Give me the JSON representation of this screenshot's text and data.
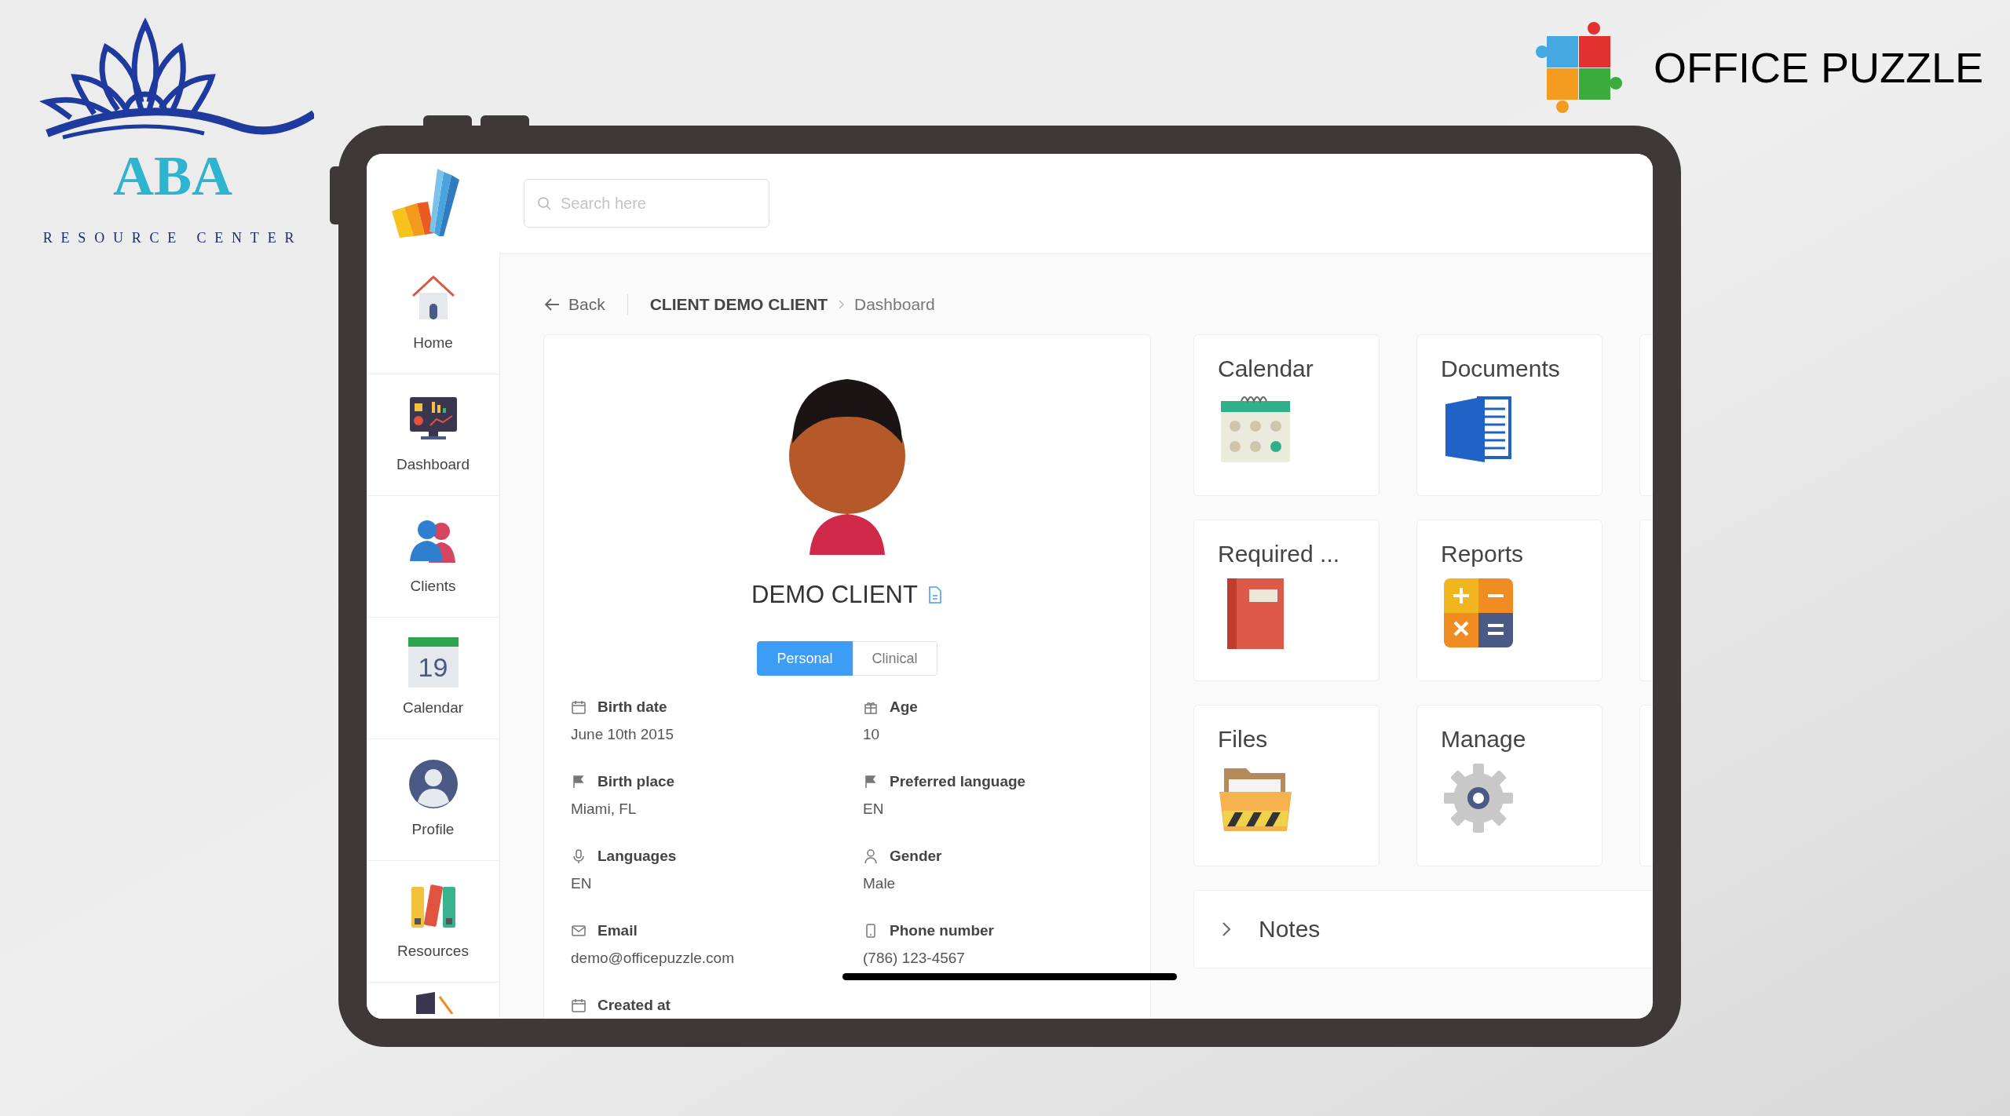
{
  "brand_left": {
    "title": "ABA",
    "subtitle": "RESOURCE CENTER"
  },
  "brand_right": {
    "title": "OFFICE PUZZLE"
  },
  "app": {
    "search": {
      "placeholder": "Search here"
    },
    "sidebar": {
      "items": [
        {
          "label": "Home",
          "kind": "home"
        },
        {
          "label": "Dashboard",
          "kind": "dashboard"
        },
        {
          "label": "Clients",
          "kind": "clients"
        },
        {
          "label": "Calendar",
          "kind": "calendar",
          "icon_text": "19"
        },
        {
          "label": "Profile",
          "kind": "profile"
        },
        {
          "label": "Resources",
          "kind": "resources"
        }
      ]
    },
    "breadcrumb": {
      "back": "Back",
      "items": [
        "CLIENT DEMO CLIENT",
        "Dashboard"
      ]
    },
    "client": {
      "name": "DEMO CLIENT",
      "tabs": [
        {
          "label": "Personal",
          "selected": true
        },
        {
          "label": "Clinical",
          "selected": false
        }
      ],
      "fields": [
        {
          "label": "Birth date",
          "value": "June 10th 2015",
          "kind": "calendar"
        },
        {
          "label": "Age",
          "value": "10",
          "kind": "gift"
        },
        {
          "label": "Birth place",
          "value": "Miami, FL",
          "kind": "flag"
        },
        {
          "label": "Preferred language",
          "value": "EN",
          "kind": "flag"
        },
        {
          "label": "Languages",
          "value": "EN",
          "kind": "mic"
        },
        {
          "label": "Gender",
          "value": "Male",
          "kind": "user"
        },
        {
          "label": "Email",
          "value": "demo@officepuzzle.com",
          "kind": "mail"
        },
        {
          "label": "Phone number",
          "value": "(786) 123-4567",
          "kind": "phone"
        },
        {
          "label": "Created at",
          "kind": "calendar"
        }
      ]
    },
    "tiles": [
      {
        "title": "Calendar",
        "kind": "calendar"
      },
      {
        "title": "Documents",
        "kind": "documents"
      },
      {
        "title": "Required ...",
        "kind": "required"
      },
      {
        "title": "Reports",
        "kind": "reports"
      },
      {
        "title": "Files",
        "kind": "files"
      },
      {
        "title": "Manage",
        "kind": "manage"
      }
    ],
    "notes": {
      "label": "Notes",
      "expanded": false
    }
  }
}
